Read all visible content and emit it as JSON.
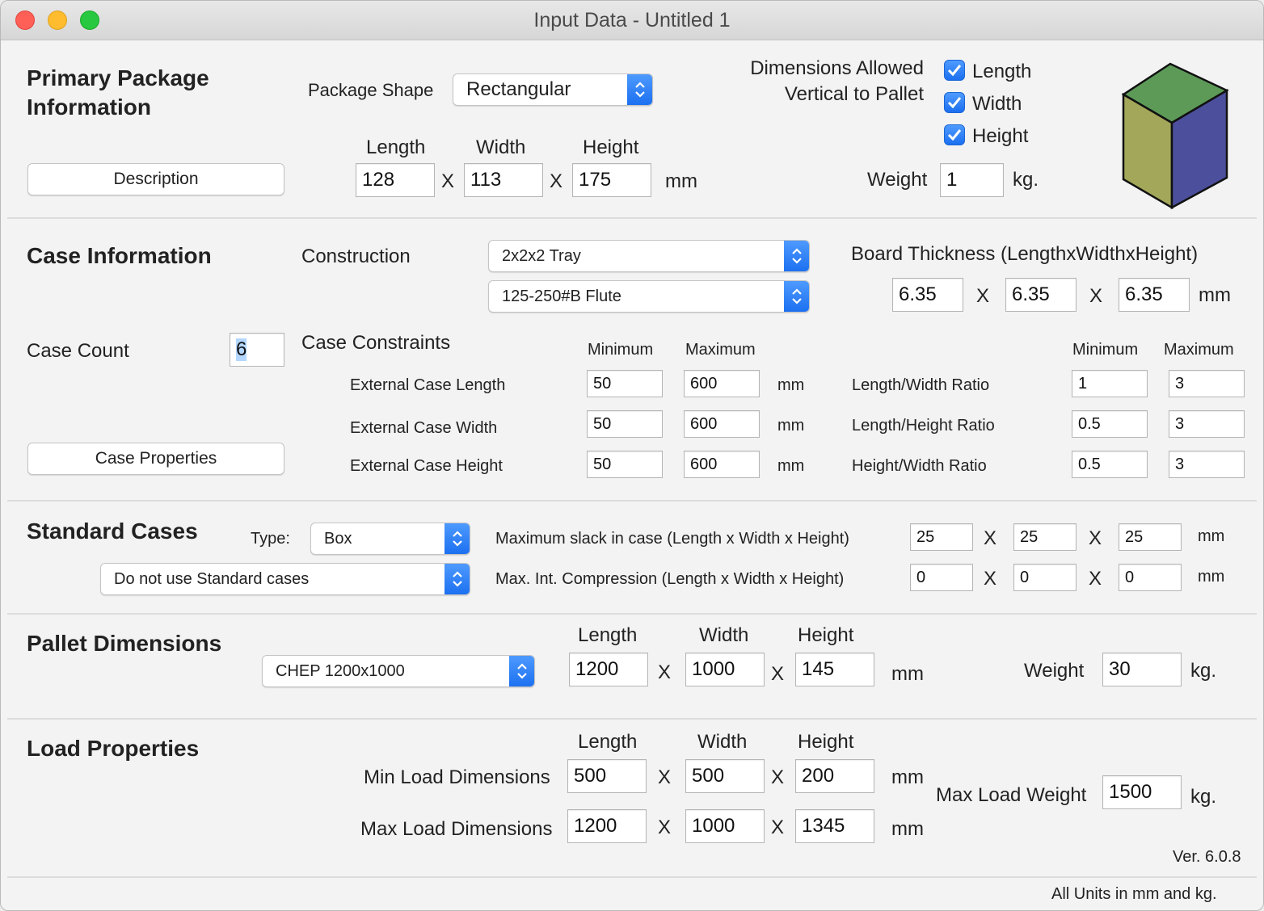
{
  "window": {
    "title": "Input Data - Untitled 1"
  },
  "primary": {
    "heading_line1": "Primary Package",
    "heading_line2": "Information",
    "shape_label": "Package Shape",
    "shape_value": "Rectangular",
    "description_button": "Description",
    "dims_header": {
      "length": "Length",
      "width": "Width",
      "height": "Height"
    },
    "length": "128",
    "width": "113",
    "height": "175",
    "x": "X",
    "unit": "mm",
    "allowed_line1": "Dimensions Allowed",
    "allowed_line2": "Vertical to Pallet",
    "checkboxes": [
      {
        "label": "Length",
        "checked": true
      },
      {
        "label": "Width",
        "checked": true
      },
      {
        "label": "Height",
        "checked": true
      }
    ],
    "weight_label": "Weight",
    "weight_value": "1",
    "weight_unit": "kg.",
    "box_colors": {
      "top": "#5d9a58",
      "left": "#a3a75a",
      "right": "#4c4f9c"
    }
  },
  "case": {
    "heading": "Case Information",
    "construction_label": "Construction",
    "construction_value": "2x2x2 Tray",
    "flute_value": "125-250#B Flute",
    "board_label": "Board Thickness (LengthxWidthxHeight)",
    "board": [
      "6.35",
      "6.35",
      "6.35"
    ],
    "x": "X",
    "unit": "mm",
    "count_label": "Case Count",
    "count_value": "6",
    "properties_button": "Case Properties",
    "constraints_label": "Case Constraints",
    "min_header": "Minimum",
    "max_header": "Maximum",
    "rows": [
      {
        "label": "External Case Length",
        "min": "50",
        "max": "600",
        "unit": "mm"
      },
      {
        "label": "External Case Width",
        "min": "50",
        "max": "600",
        "unit": "mm"
      },
      {
        "label": "External Case Height",
        "min": "50",
        "max": "600",
        "unit": "mm"
      }
    ],
    "ratio_min_header": "Minimum",
    "ratio_max_header": "Maximum",
    "ratios": [
      {
        "label": "Length/Width Ratio",
        "min": "1",
        "max": "3"
      },
      {
        "label": "Length/Height Ratio",
        "min": "0.5",
        "max": "3"
      },
      {
        "label": "Height/Width Ratio",
        "min": "0.5",
        "max": "3"
      }
    ]
  },
  "standard": {
    "heading": "Standard Cases",
    "type_label": "Type:",
    "type_value": "Box",
    "use_value": "Do not use Standard cases",
    "slack_label": "Maximum slack in case  (Length x Width x Height)",
    "slack": [
      "25",
      "25",
      "25"
    ],
    "compression_label": "Max. Int. Compression (Length x Width x Height)",
    "compression": [
      "0",
      "0",
      "0"
    ],
    "x": "X",
    "unit": "mm"
  },
  "pallet": {
    "heading": "Pallet Dimensions",
    "type_value": "CHEP 1200x1000",
    "dims_header": {
      "length": "Length",
      "width": "Width",
      "height": "Height"
    },
    "length": "1200",
    "width": "1000",
    "height": "145",
    "x": "X",
    "unit": "mm",
    "weight_label": "Weight",
    "weight_value": "30",
    "weight_unit": "kg."
  },
  "load": {
    "heading": "Load Properties",
    "dims_header": {
      "length": "Length",
      "width": "Width",
      "height": "Height"
    },
    "min_label": "Min Load Dimensions",
    "min": [
      "500",
      "500",
      "200"
    ],
    "max_label": "Max Load Dimensions",
    "max": [
      "1200",
      "1000",
      "1345"
    ],
    "x": "X",
    "unit": "mm",
    "max_weight_label": "Max Load Weight",
    "max_weight_value": "1500",
    "max_weight_unit": "kg."
  },
  "footer": {
    "version": "Ver. 6.0.8",
    "units_note": "All Units in mm and kg."
  }
}
